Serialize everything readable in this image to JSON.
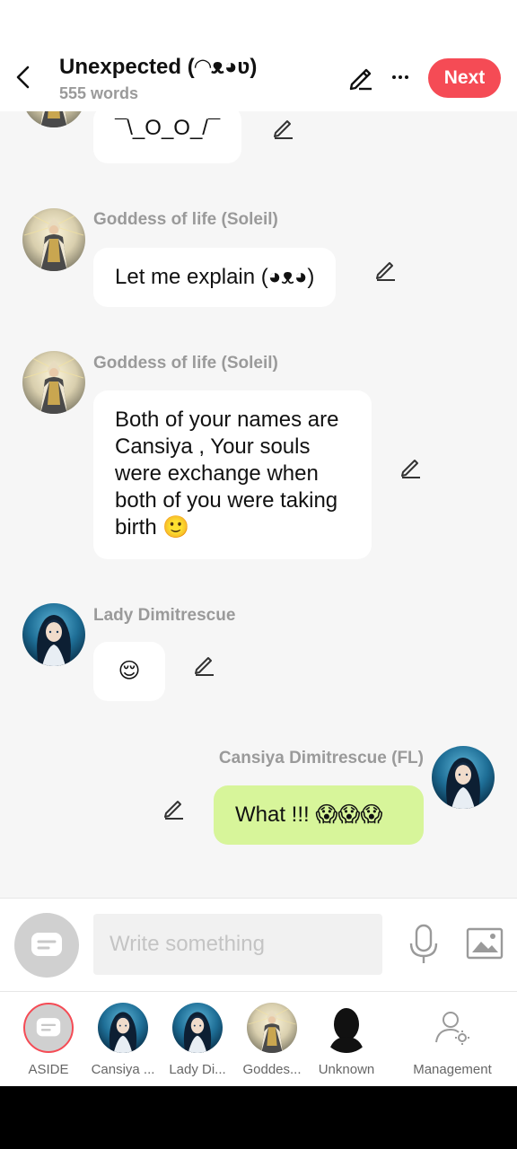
{
  "header": {
    "title": "Unexpected (◠ᴥ◕ʋ)",
    "word_count": "555 words",
    "next_label": "Next"
  },
  "messages": [
    {
      "sender": "",
      "text": "¯\\_O_O_/¯",
      "side": "left"
    },
    {
      "sender": "Goddess of life (Soleil)",
      "text": "Let me explain (◕ᴥ◕)",
      "side": "left"
    },
    {
      "sender": "Goddess of life (Soleil)",
      "text": "Both of your names are Cansiya , Your souls were exchange when both of you were taking birth 🙂",
      "side": "left"
    },
    {
      "sender": "Lady Dimitrescue",
      "text": "😌",
      "side": "left"
    },
    {
      "sender": "Cansiya Dimitrescue (FL)",
      "text": "What !!! 😱😱😱",
      "side": "right"
    }
  ],
  "composer": {
    "placeholder": "Write something"
  },
  "characters": [
    {
      "label": "ASIDE"
    },
    {
      "label": "Cansiya ..."
    },
    {
      "label": "Lady Di..."
    },
    {
      "label": "Goddes..."
    },
    {
      "label": "Unknown"
    },
    {
      "label": "Management"
    }
  ],
  "colors": {
    "accent": "#f54b55",
    "own_bubble": "#d7f59a",
    "other_bubble": "#ffffff",
    "background": "#f6f6f6"
  },
  "icons": {
    "back": "chevron-left-icon",
    "edit": "pencil-icon",
    "more": "more-horizontal-icon",
    "aside": "chat-bubble-icon",
    "mic": "microphone-icon",
    "image": "image-icon",
    "management": "user-settings-icon"
  }
}
